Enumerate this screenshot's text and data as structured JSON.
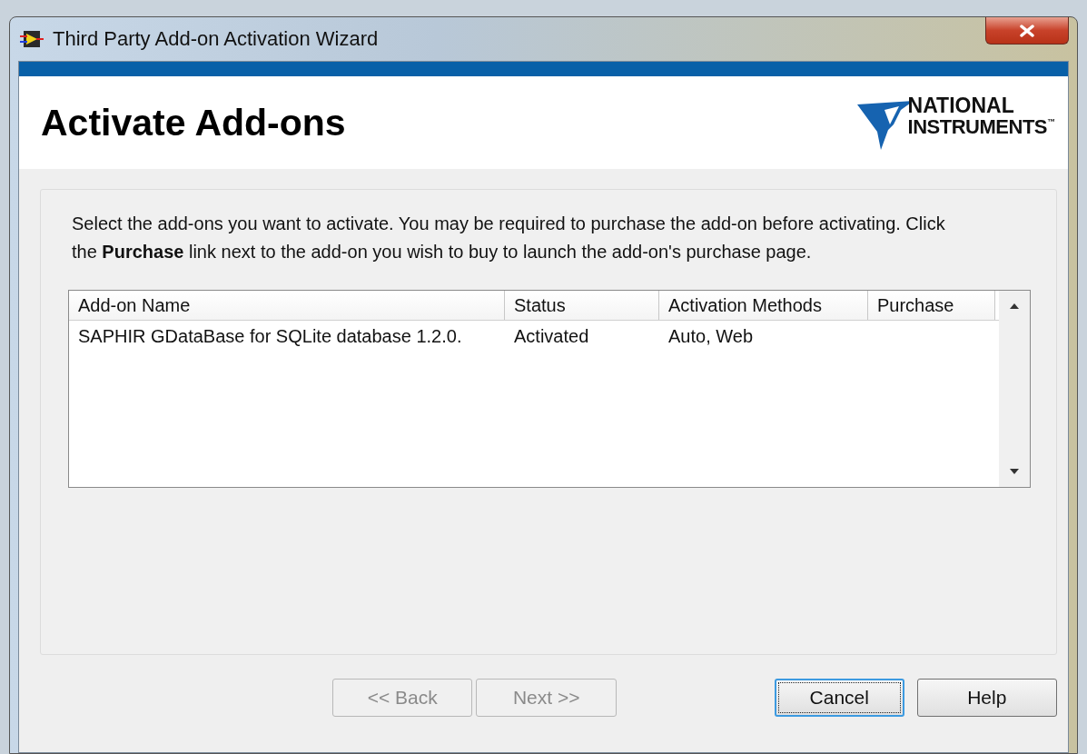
{
  "window": {
    "title": "Third Party Add-on Activation Wizard"
  },
  "header": {
    "title": "Activate Add-ons",
    "logo": {
      "line_1": "NATIONAL",
      "line_2": "INSTRUMENTS",
      "trademark": "™"
    }
  },
  "instructions": "Select the add-ons you want to activate. You may be required to purchase the add-on before activating. Click the **Purchase** link next to the add-on you wish to buy to launch the add-on's purchase page.",
  "table": {
    "columns": [
      "Add-on Name",
      "Status",
      "Activation Methods",
      "Purchase"
    ],
    "rows": [
      {
        "cells": [
          "SAPHIR GDataBase for SQLite database 1.2.0.",
          "Activated",
          "Auto, Web",
          ""
        ]
      }
    ]
  },
  "buttons": [
    {
      "label": "<< Back",
      "disabled": true,
      "focused": false
    },
    {
      "label": "Next >>",
      "disabled": true,
      "focused": false
    },
    {
      "label": "Cancel",
      "disabled": false,
      "focused": true
    },
    {
      "label": "Help",
      "disabled": false,
      "focused": false
    }
  ]
}
